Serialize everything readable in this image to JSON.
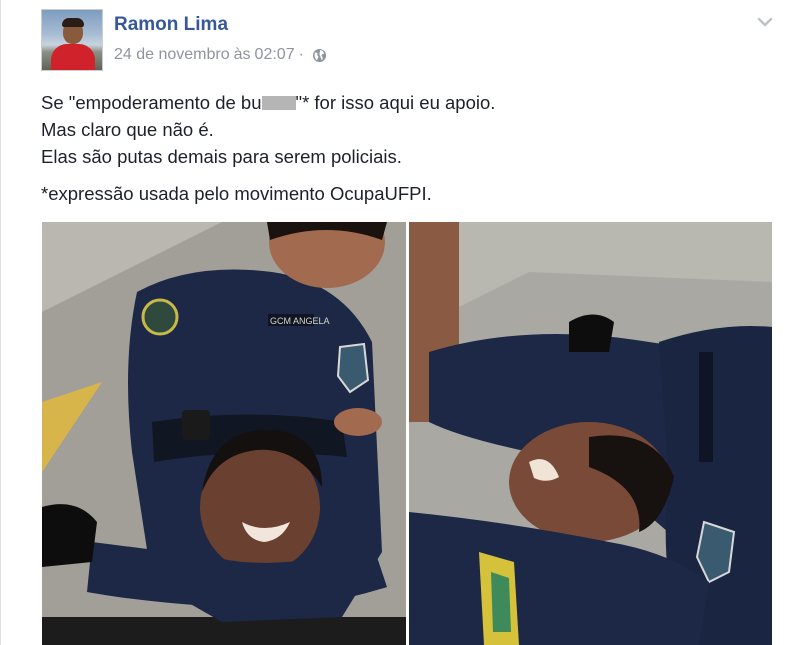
{
  "post": {
    "author": {
      "name": "Ramon Lima"
    },
    "timestamp": {
      "date": "24 de novembro",
      "separator": "às",
      "time": "02:07"
    },
    "privacy_icon": "globe-icon",
    "options_icon": "chevron-down-icon",
    "text": {
      "line1_before": "Se \"empoderamento de bu",
      "line1_after": "\"* for isso aqui eu apoio.",
      "line2": "Mas claro que não é.",
      "line3": "Elas são putas demais para serem policiais.",
      "line4": "*expressão usada pelo movimento OcupaUFPI."
    },
    "uniform_tag": "GCM ANGELA"
  },
  "colors": {
    "author_link": "#365899",
    "meta_text": "#90949c",
    "body_text": "#1d2129",
    "uniform": "#1c2846"
  }
}
